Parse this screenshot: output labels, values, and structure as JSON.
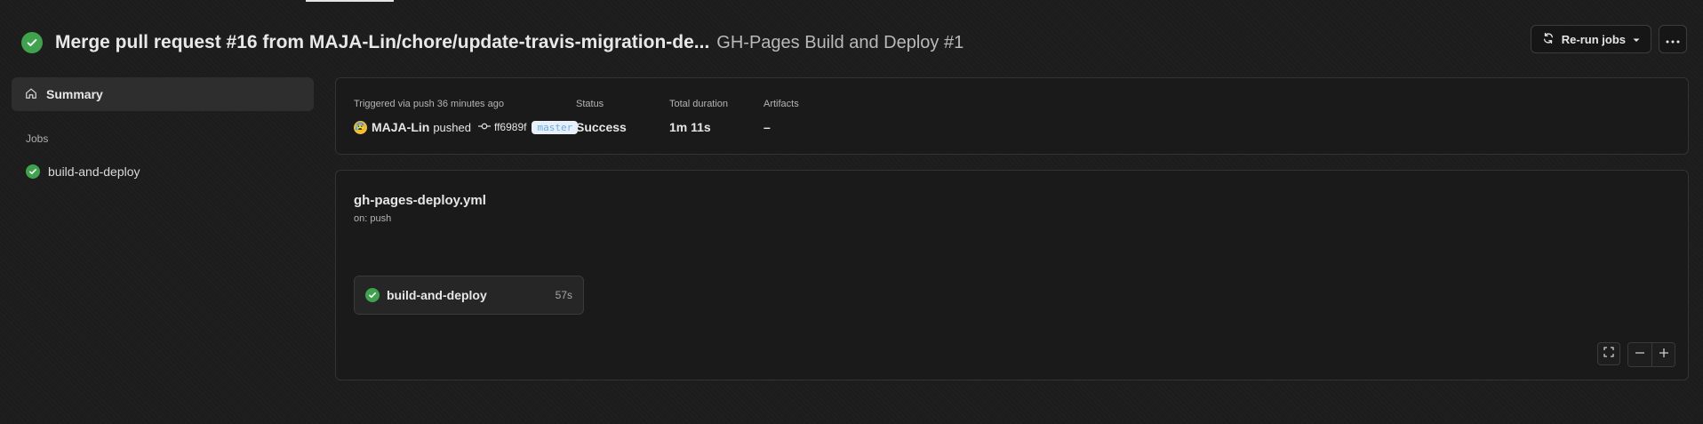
{
  "header": {
    "title": "Merge pull request #16 from MAJA-Lin/chore/update-travis-migration-de...",
    "subtitle": "GH-Pages Build and Deploy #1",
    "rerun_label": "Re-run jobs"
  },
  "sidebar": {
    "summary_label": "Summary",
    "jobs_heading": "Jobs",
    "jobs": [
      {
        "label": "build-and-deploy",
        "status": "success"
      }
    ]
  },
  "summary": {
    "trigger_label": "Triggered via push 36 minutes ago",
    "actor": "MAJA-Lin",
    "action": "pushed",
    "commit": "ff6989f",
    "branch": "master",
    "status_label": "Status",
    "status_value": "Success",
    "duration_label": "Total duration",
    "duration_value": "1m 11s",
    "artifacts_label": "Artifacts",
    "artifacts_value": "–"
  },
  "workflow": {
    "file": "gh-pages-deploy.yml",
    "trigger": "on: push",
    "job": {
      "name": "build-and-deploy",
      "duration": "57s"
    }
  },
  "colors": {
    "success": "#3fa34d",
    "background": "#1c1c1c",
    "panel": "#1a1a1a",
    "branch_text": "#6aa9ff"
  }
}
